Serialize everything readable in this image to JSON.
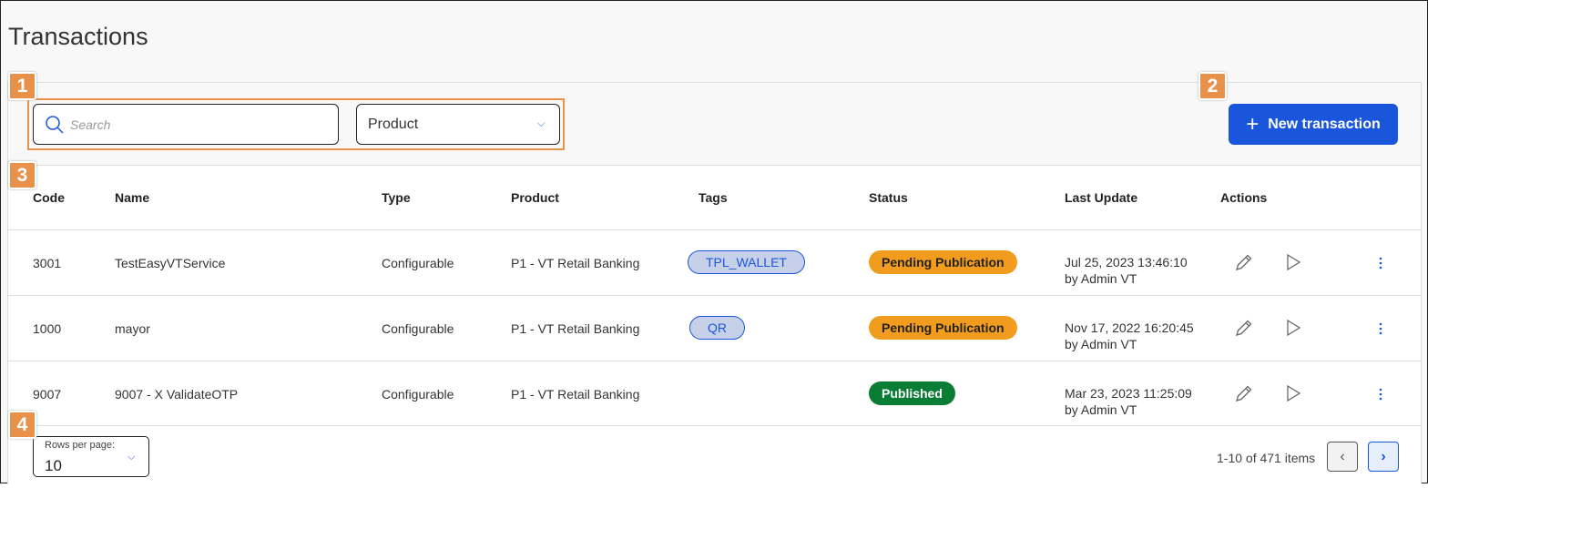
{
  "page": {
    "title": "Transactions"
  },
  "toolbar": {
    "search_placeholder": "Search",
    "product_select": "Product",
    "new_button": "New transaction"
  },
  "table": {
    "headers": [
      "Code",
      "Name",
      "Type",
      "Product",
      "Tags",
      "Status",
      "Last Update",
      "Actions"
    ],
    "rows": [
      {
        "code": "3001",
        "name": "TestEasyVTService",
        "type": "Configurable",
        "product": "P1 - VT Retail Banking",
        "tag": "TPL_WALLET",
        "status": "Pending Publication",
        "date": "Jul 25, 2023 13:46:10",
        "by": "by Admin VT"
      },
      {
        "code": "1000",
        "name": "mayor",
        "type": "Configurable",
        "product": "P1 - VT Retail Banking",
        "tag": "QR",
        "status": "Pending Publication",
        "date": "Nov 17, 2022 16:20:45",
        "by": "by Admin VT"
      },
      {
        "code": "9007",
        "name": "9007 - X ValidateOTP",
        "type": "Configurable",
        "product": "P1 - VT Retail Banking",
        "tag": null,
        "status": "Published",
        "date": "Mar 23, 2023 11:25:09",
        "by": "by Admin VT"
      }
    ]
  },
  "footer": {
    "rows_per_page_label": "Rows per page:",
    "rows_per_page": "10",
    "count": "1-10 of 471 items"
  },
  "annotations": [
    "1",
    "2",
    "3",
    "4"
  ],
  "colors": {
    "accent": "#1a56db",
    "pending": "#f29c1f",
    "published": "#0a7d34",
    "annotation": "#e8914a",
    "tag_bg": "#c6d0e8"
  }
}
